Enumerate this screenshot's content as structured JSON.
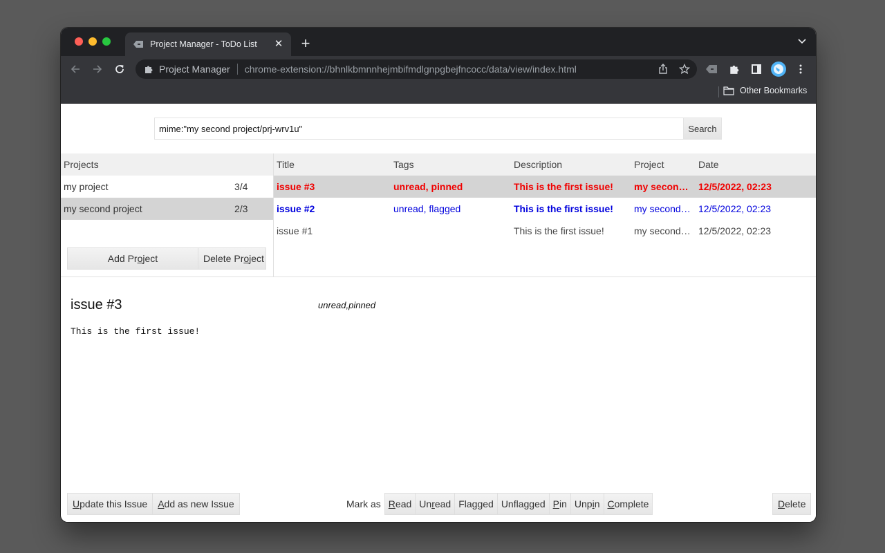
{
  "browser": {
    "tab_title": "Project Manager - ToDo List",
    "omnibox_site": "Project Manager",
    "omnibox_url": "chrome-extension://bhnlkbmnnhejmbifmdlgnpgbejfncocc/data/view/index.html",
    "bookmarks_folder": "Other Bookmarks"
  },
  "search": {
    "value": "mime:\"my second project/prj-wrv1u\"",
    "button_label": "Search"
  },
  "projects": {
    "header": "Projects",
    "items": [
      {
        "name": "my project",
        "count": "3/4",
        "selected": false
      },
      {
        "name": "my second project",
        "count": "2/3",
        "selected": true
      }
    ],
    "add_button": {
      "pre": "Add Pr",
      "key": "o",
      "post": "ject"
    },
    "delete_button": {
      "pre": "Delete Pr",
      "key": "o",
      "post": "ject"
    }
  },
  "issues": {
    "columns": [
      "Title",
      "Tags",
      "Description",
      "Project",
      "Date"
    ],
    "rows": [
      {
        "title": "issue #3",
        "tags": "unread, pinned",
        "description": "This is the first issue!",
        "project": "my second project",
        "date": "12/5/2022, 02:23",
        "style": "pinned",
        "selected": true
      },
      {
        "title": "issue #2",
        "tags": "unread, flagged",
        "description": "This is the first issue!",
        "project": "my second project",
        "date": "12/5/2022, 02:23",
        "style": "flagged",
        "selected": false
      },
      {
        "title": "issue #1",
        "tags": "",
        "description": "This is the first issue!",
        "project": "my second project",
        "date": "12/5/2022, 02:23",
        "style": "normal",
        "selected": false
      }
    ]
  },
  "colors": {
    "pinned": "#f00000",
    "flagged": "#0000dd",
    "selected_row": "#d4d4d4"
  },
  "detail": {
    "title": "issue #3",
    "tags": "unread,pinned",
    "body": "This is the first issue!"
  },
  "actions": {
    "update": {
      "key": "U",
      "post": "pdate this Issue"
    },
    "add_new": {
      "key": "A",
      "post": "dd as new Issue"
    },
    "mark_as_label": "Mark as",
    "mark": {
      "read": {
        "pre": "",
        "key": "R",
        "post": "ead"
      },
      "unread": {
        "pre": "Un",
        "key": "r",
        "post": "ead"
      },
      "flagged": {
        "pre": "Flagged",
        "key": "",
        "post": ""
      },
      "unflagged": {
        "pre": "Unflagged",
        "key": "",
        "post": ""
      },
      "pin": {
        "pre": "",
        "key": "P",
        "post": "in"
      },
      "unpin": {
        "pre": "Unp",
        "key": "i",
        "post": "n"
      },
      "complete": {
        "pre": "",
        "key": "C",
        "post": "omplete"
      }
    },
    "delete": {
      "key": "D",
      "post": "elete"
    }
  }
}
